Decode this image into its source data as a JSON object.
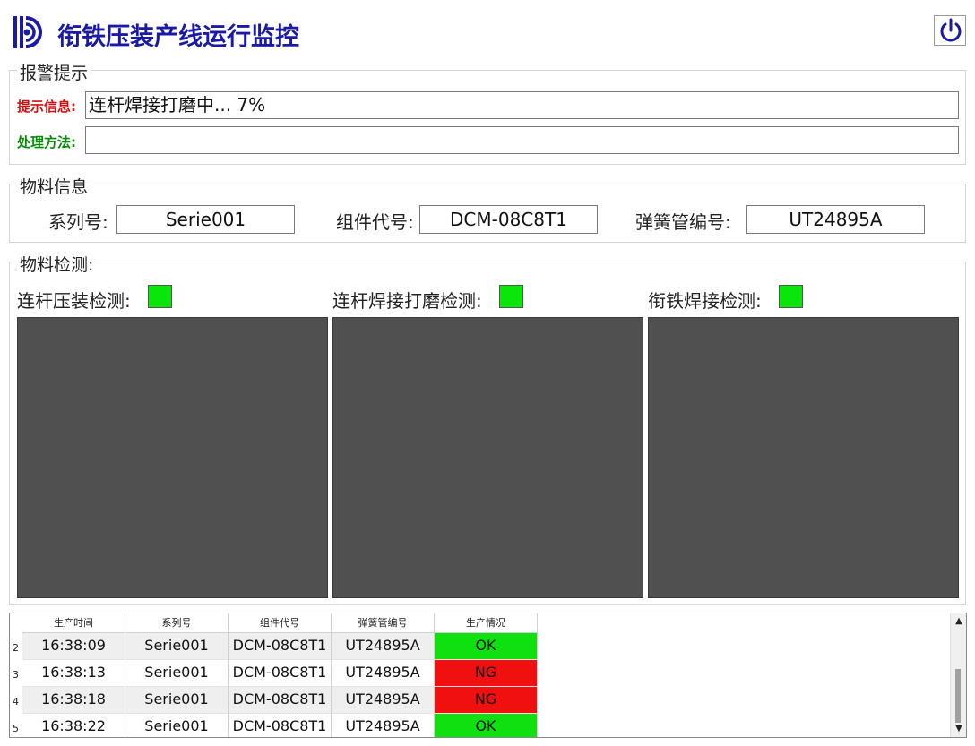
{
  "app": {
    "title": "衔铁压装产线运行监控",
    "brand_color": "#1a1aa6"
  },
  "alarm": {
    "legend": "报警提示",
    "info_label": "提示信息:",
    "info_value": "连杆焊接打磨中... 7%",
    "method_label": "处理方法:",
    "method_value": ""
  },
  "material": {
    "legend": "物料信息",
    "series_label": "系列号:",
    "series_value": "Serie001",
    "component_label": "组件代号:",
    "component_value": "DCM-08C8T1",
    "spring_label": "弹簧管编号:",
    "spring_value": "UT24895A"
  },
  "detection": {
    "legend": "物料检测:",
    "items": [
      {
        "label": "连杆压装检测:",
        "status_color": "#0ae60a"
      },
      {
        "label": "连杆焊接打磨检测:",
        "status_color": "#0ae60a"
      },
      {
        "label": "衔铁焊接检测:",
        "status_color": "#0ae60a"
      }
    ]
  },
  "table": {
    "headers": [
      "生产时间",
      "系列号",
      "组件代号",
      "弹簧管编号",
      "生产情况"
    ],
    "rows": [
      {
        "num": "2",
        "time": "16:38:09",
        "series": "Serie001",
        "component": "DCM-08C8T1",
        "spring": "UT24895A",
        "status": "OK"
      },
      {
        "num": "3",
        "time": "16:38:13",
        "series": "Serie001",
        "component": "DCM-08C8T1",
        "spring": "UT24895A",
        "status": "NG"
      },
      {
        "num": "4",
        "time": "16:38:18",
        "series": "Serie001",
        "component": "DCM-08C8T1",
        "spring": "UT24895A",
        "status": "NG"
      },
      {
        "num": "5",
        "time": "16:38:22",
        "series": "Serie001",
        "component": "DCM-08C8T1",
        "spring": "UT24895A",
        "status": "OK"
      }
    ],
    "ok_color": "#10e010",
    "ng_color": "#f01010"
  },
  "icons": {
    "logo": "logo-icon",
    "power": "power-icon",
    "scroll_up": "▲",
    "scroll_down": "▼"
  }
}
